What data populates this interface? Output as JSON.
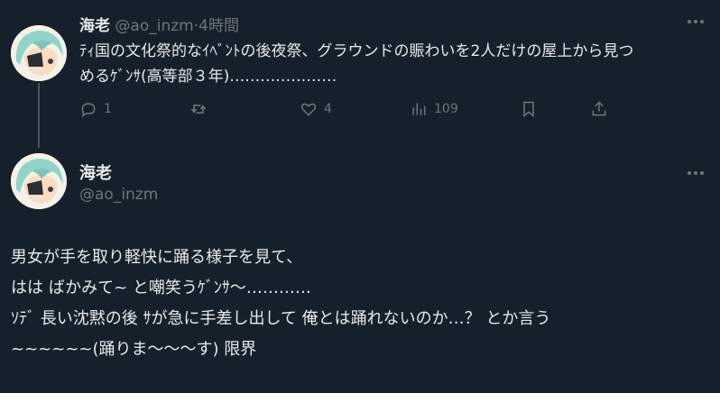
{
  "post1": {
    "display_name": "海老",
    "handle": "@ao_inzm",
    "separator": "·",
    "time": "4時間",
    "text_lines": [
      "ﾃｨ国の文化祭的なｲﾍﾞﾝﾄの後夜祭、グラウンドの賑わいを2人だけの屋上から見つ",
      "めるｹﾞﾝｻ(高等部３年)…………………"
    ],
    "actions": {
      "reply_icon": "speech-bubble-icon",
      "reply_count": "1",
      "repost_icon": "repost-arrows-icon",
      "repost_count": "",
      "like_icon": "heart-icon",
      "like_count": "4",
      "views_icon": "bar-chart-icon",
      "views_count": "109",
      "bookmark_icon": "bookmark-icon",
      "share_icon": "share-upload-icon"
    }
  },
  "post2": {
    "display_name": "海老",
    "handle": "@ao_inzm",
    "text_lines": [
      "男女が手を取り軽快に踊る様子を見て、",
      "はは ばかみて~ と嘲笑うｹﾞﾝｻ〜…………",
      "ｿﾃﾞ 長い沈黙の後 ｻが急に手差し出して 俺とは踊れないのか…？ とか言う",
      "~~~~~~(踊りま〜〜〜す)  限界"
    ]
  },
  "colors": {
    "background": "#15202b",
    "text": "#e7e9ea",
    "secondary": "#71767b",
    "avatar_hair": "#8fd3c9"
  }
}
